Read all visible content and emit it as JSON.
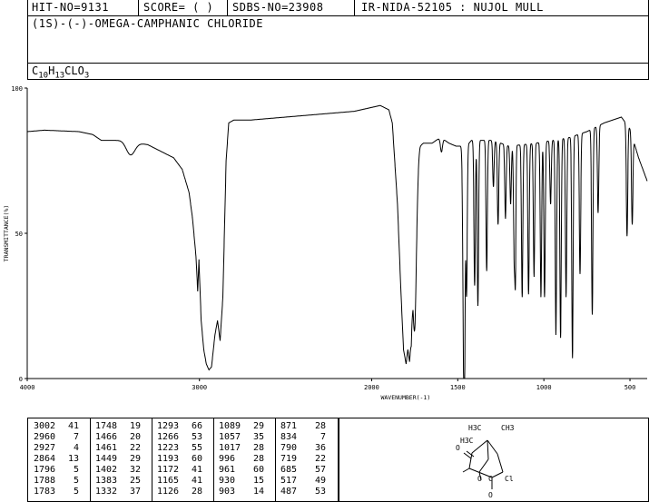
{
  "header": {
    "hit_no": "HIT-NO=9131",
    "score": "SCORE=  (   )",
    "sdbs_no": "SDBS-NO=23908",
    "ir_info": "IR-NIDA-52105 : NUJOL MULL"
  },
  "compound": {
    "name": "(1S)-(-)-OMEGA-CAMPHANIC CHLORIDE",
    "formula_parts": [
      "C",
      "10",
      "H",
      "13",
      "CLO",
      "3"
    ]
  },
  "chart_data": {
    "type": "line",
    "xlabel": "WAVENUMBER(-1)",
    "ylabel": "TRANSMITTANCE(%)",
    "xlim": [
      4000,
      400
    ],
    "ylim": [
      0,
      100
    ],
    "xticks": [
      4000,
      3000,
      2000,
      1500,
      1000,
      500
    ],
    "xtick_labels": [
      "4000",
      "3000",
      "2000",
      "1500",
      "1000",
      "500"
    ],
    "yticks": [
      0,
      50,
      100
    ],
    "ytick_labels": [
      "0",
      "50",
      "100"
    ],
    "baseline": [
      [
        4000,
        85
      ],
      [
        3900,
        85.5
      ],
      [
        3700,
        85
      ],
      [
        3620,
        84
      ],
      [
        3570,
        82
      ],
      [
        3450,
        82
      ],
      [
        3300,
        80.5
      ],
      [
        3150,
        76
      ],
      [
        3100,
        72
      ],
      [
        3060,
        64
      ],
      [
        3040,
        55
      ],
      [
        3020,
        42
      ],
      [
        3010,
        30
      ],
      [
        3003,
        41
      ],
      [
        2990,
        20
      ],
      [
        2975,
        10
      ],
      [
        2960,
        5
      ],
      [
        2945,
        3
      ],
      [
        2930,
        4
      ],
      [
        2910,
        15
      ],
      [
        2895,
        20
      ],
      [
        2880,
        13
      ],
      [
        2864,
        28
      ],
      [
        2845,
        75
      ],
      [
        2830,
        88
      ],
      [
        2800,
        89
      ],
      [
        2700,
        89
      ],
      [
        2500,
        90
      ],
      [
        2300,
        91
      ],
      [
        2100,
        92
      ],
      [
        1950,
        94
      ],
      [
        1900,
        92.5
      ],
      [
        1880,
        88
      ],
      [
        1850,
        60
      ],
      [
        1830,
        30
      ],
      [
        1815,
        10
      ],
      [
        1800,
        5
      ],
      [
        1790,
        10
      ],
      [
        1780,
        6
      ],
      [
        1770,
        15
      ],
      [
        1760,
        45
      ],
      [
        1740,
        75
      ],
      [
        1720,
        80
      ],
      [
        1700,
        81
      ],
      [
        1650,
        81
      ],
      [
        1600,
        83
      ],
      [
        1550,
        81
      ],
      [
        1510,
        80
      ],
      [
        1500,
        80
      ],
      [
        1450,
        80
      ],
      [
        1420,
        82
      ],
      [
        1300,
        82
      ],
      [
        1200,
        80
      ],
      [
        1050,
        81
      ],
      [
        950,
        82
      ],
      [
        850,
        83
      ],
      [
        750,
        85
      ],
      [
        650,
        88
      ],
      [
        550,
        90
      ],
      [
        500,
        86
      ],
      [
        450,
        76
      ],
      [
        400,
        68
      ]
    ],
    "peaks": [
      {
        "x": 3400,
        "y": 77,
        "w": 25
      },
      {
        "x": 1748,
        "y": 19,
        "w": 10
      },
      {
        "x": 1595,
        "y": 78,
        "w": 6
      },
      {
        "x": 1466,
        "y": 20,
        "w": 5
      },
      {
        "x": 1461,
        "y": 22,
        "w": 4
      },
      {
        "x": 1449,
        "y": 29,
        "w": 4
      },
      {
        "x": 1402,
        "y": 32,
        "w": 4
      },
      {
        "x": 1383,
        "y": 25,
        "w": 4
      },
      {
        "x": 1332,
        "y": 37,
        "w": 4
      },
      {
        "x": 1293,
        "y": 66,
        "w": 4
      },
      {
        "x": 1266,
        "y": 53,
        "w": 4
      },
      {
        "x": 1223,
        "y": 55,
        "w": 4
      },
      {
        "x": 1193,
        "y": 60,
        "w": 4
      },
      {
        "x": 1172,
        "y": 41,
        "w": 4
      },
      {
        "x": 1165,
        "y": 41,
        "w": 3
      },
      {
        "x": 1126,
        "y": 28,
        "w": 4
      },
      {
        "x": 1089,
        "y": 29,
        "w": 4
      },
      {
        "x": 1057,
        "y": 35,
        "w": 4
      },
      {
        "x": 1017,
        "y": 28,
        "w": 4
      },
      {
        "x": 996,
        "y": 28,
        "w": 4
      },
      {
        "x": 961,
        "y": 60,
        "w": 4
      },
      {
        "x": 930,
        "y": 15,
        "w": 4
      },
      {
        "x": 903,
        "y": 14,
        "w": 4
      },
      {
        "x": 871,
        "y": 28,
        "w": 4
      },
      {
        "x": 834,
        "y": 7,
        "w": 4
      },
      {
        "x": 790,
        "y": 36,
        "w": 4
      },
      {
        "x": 719,
        "y": 22,
        "w": 4
      },
      {
        "x": 685,
        "y": 57,
        "w": 4
      },
      {
        "x": 517,
        "y": 49,
        "w": 4
      },
      {
        "x": 487,
        "y": 53,
        "w": 4
      }
    ]
  },
  "peak_table": [
    [
      [
        "3002",
        "41"
      ],
      [
        "2960",
        "7"
      ],
      [
        "2927",
        "4"
      ],
      [
        "2864",
        "13"
      ],
      [
        "1796",
        "5"
      ],
      [
        "1788",
        "5"
      ],
      [
        "1783",
        "5"
      ]
    ],
    [
      [
        "1748",
        "19"
      ],
      [
        "1466",
        "20"
      ],
      [
        "1461",
        "22"
      ],
      [
        "1449",
        "29"
      ],
      [
        "1402",
        "32"
      ],
      [
        "1383",
        "25"
      ],
      [
        "1332",
        "37"
      ]
    ],
    [
      [
        "1293",
        "66"
      ],
      [
        "1266",
        "53"
      ],
      [
        "1223",
        "55"
      ],
      [
        "1193",
        "60"
      ],
      [
        "1172",
        "41"
      ],
      [
        "1165",
        "41"
      ],
      [
        "1126",
        "28"
      ]
    ],
    [
      [
        "1089",
        "29"
      ],
      [
        "1057",
        "35"
      ],
      [
        "1017",
        "28"
      ],
      [
        "996",
        "28"
      ],
      [
        "961",
        "60"
      ],
      [
        "930",
        "15"
      ],
      [
        "903",
        "14"
      ]
    ],
    [
      [
        "871",
        "28"
      ],
      [
        "834",
        "7"
      ],
      [
        "790",
        "36"
      ],
      [
        "719",
        "22"
      ],
      [
        "685",
        "57"
      ],
      [
        "517",
        "49"
      ],
      [
        "487",
        "53"
      ]
    ]
  ],
  "structure": {
    "labels": [
      "H3C",
      "CH3",
      "H3C",
      "O",
      "O",
      "C",
      "Cl",
      "O"
    ]
  }
}
